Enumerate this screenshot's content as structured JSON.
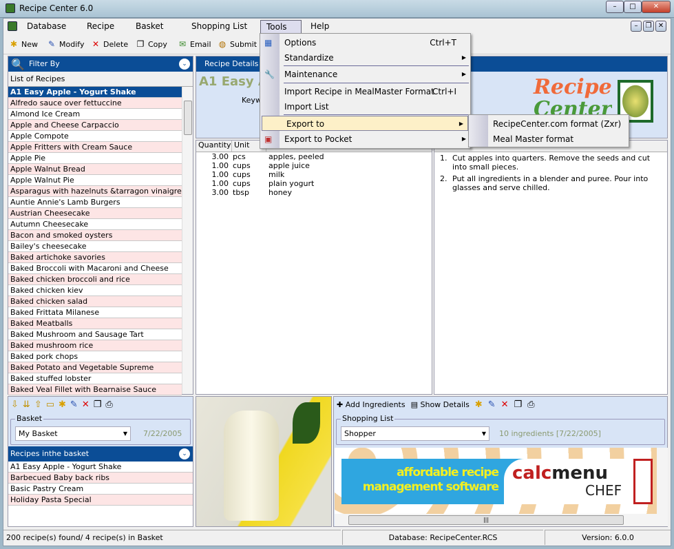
{
  "window": {
    "title": "Recipe Center 6.0",
    "min": "–",
    "max": "□",
    "close": "✕"
  },
  "menubar": [
    "Database",
    "Recipe",
    "Basket",
    "Shopping List",
    "Tools",
    "Help"
  ],
  "toolbar": [
    "New",
    "Modify",
    "Delete",
    "Copy",
    "Email",
    "Submit"
  ],
  "filter": {
    "header": "Filter By",
    "list_label": "List of Recipes"
  },
  "recipes": [
    "A1 Easy Apple - Yogurt Shake",
    "Alfredo sauce over fettuccine",
    "Almond Ice Cream",
    "Apple and Cheese Carpaccio",
    "Apple Compote",
    "Apple Fritters with Cream Sauce",
    "Apple Pie",
    "Apple Walnut Bread",
    "Apple Walnut Pie",
    "Asparagus with hazelnuts &tarragon vinaigrette",
    "Auntie Annie's Lamb Burgers",
    "Austrian Cheesecake",
    "Autumn Cheesecake",
    "Bacon and smoked oysters",
    "Bailey's cheesecake",
    "Baked artichoke savories",
    "Baked Broccoli with Macaroni and Cheese",
    "Baked chicken broccoli and rice",
    "Baked chicken kiev",
    "Baked chicken salad",
    "Baked Frittata Milanese",
    "Baked Meatballs",
    "Baked Mushroom and Sausage Tart",
    "Baked mushroom rice",
    "Baked pork chops",
    "Baked Potato and Vegetable Supreme",
    "Baked stuffed lobster",
    "Baked Veal Fillet with Bearnaise Sauce"
  ],
  "details": {
    "header": "Recipe Details",
    "title": "A1 Easy Ap",
    "keyword_label": "Keyw",
    "logo_top": "Recipe",
    "logo_bottom": "Center"
  },
  "ingredients": {
    "headers": [
      "Quantity",
      "Unit"
    ],
    "rows": [
      [
        "3.00",
        "pcs",
        "apples, peeled"
      ],
      [
        "1.00",
        "cups",
        "apple juice"
      ],
      [
        "1.00",
        "cups",
        "milk"
      ],
      [
        "1.00",
        "cups",
        "plain yogurt"
      ],
      [
        "3.00",
        "tbsp",
        "honey"
      ]
    ]
  },
  "instructions": [
    {
      "n": "1.",
      "text": "Cut apples into quarters. Remove the seeds and cut into small pieces."
    },
    {
      "n": "2.",
      "text": "Put all ingredients in a blender and puree. Pour into glasses and serve chilled."
    }
  ],
  "tools_menu": [
    {
      "label": "Options",
      "shortcut": "Ctrl+T"
    },
    {
      "label": "Standardize",
      "sub": true
    },
    {
      "label": "Maintenance",
      "sub": true
    },
    {
      "label": "Import Recipe in MealMaster Format",
      "shortcut": "Ctrl+I"
    },
    {
      "label": "Import List"
    },
    {
      "label": "Export to",
      "sub": true
    },
    {
      "label": "Export to Pocket",
      "sub": true
    }
  ],
  "export_submenu": [
    "RecipeCenter.com format (Zxr)",
    "Meal Master format"
  ],
  "basket": {
    "group": "Basket",
    "selected": "My Basket",
    "date": "7/22/2005",
    "list_header": "Recipes inthe basket",
    "items": [
      "A1 Easy Apple - Yogurt Shake",
      "Barbecued Baby back ribs",
      "Basic Pastry Cream",
      "Holiday Pasta Special"
    ]
  },
  "shopping": {
    "add": "Add Ingredients",
    "show": "Show Details",
    "group": "Shopping List",
    "selected": "Shopper",
    "info": "10 ingredients  [7/22/2005]"
  },
  "ad": {
    "line1": "affordable recipe",
    "line2": "management software",
    "brand1": "calc",
    "brand2": "menu",
    "brand3": "CHEF"
  },
  "status": {
    "found": "200 recipe(s) found/ 4 recipe(s) in Basket",
    "database": "Database: RecipeCenter.RCS",
    "version": "Version: 6.0.0"
  },
  "colors": {
    "header": "#0b4d96",
    "odd_row": "#fde5e5",
    "panel": "#d8e4f6",
    "menu_hl": "#fdf0c8"
  }
}
